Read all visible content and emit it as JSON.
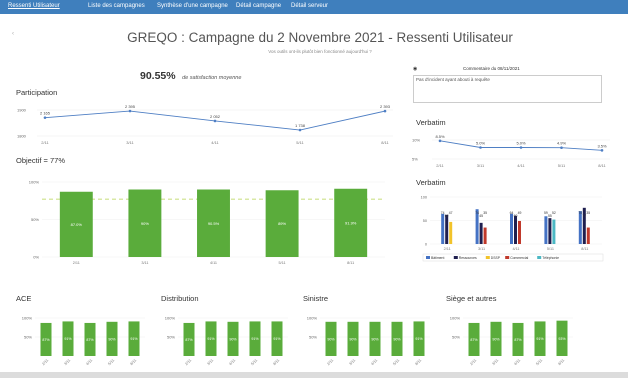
{
  "nav": {
    "items": [
      "Ressenti Utilisateur",
      "Liste des campagnes",
      "Synthèse d'une campagne",
      "Détail campagne",
      "Détail serveur"
    ]
  },
  "page": {
    "title": "GREQO : Campagne du 2 Novembre 2021 - Ressenti Utilisateur",
    "subtitle": "Vos outils ont-ils plutôt bien fonctionné aujourd'hui ?",
    "satisfaction_value": "90.55%",
    "satisfaction_label": "de satisfaction moyenne",
    "back_icon": "chevron-left-icon"
  },
  "comment": {
    "header": "Commentaire du 08/11/2021",
    "text": "Pas d'incident ayant abouti à requête"
  },
  "sections": {
    "participation": "Participation",
    "objectif": "Objectif = 77%",
    "verbatim1": "Verbatim",
    "verbatim2": "Verbatim",
    "ace": "ACE",
    "distribution": "Distribution",
    "sinistre": "Sinistre",
    "siege": "Siège et autres"
  },
  "chart_data": [
    {
      "id": "participation",
      "type": "line",
      "x": [
        "2/11",
        "3/11",
        "4/11",
        "5/11",
        "8/11"
      ],
      "y_ticks": [
        "1900",
        "1800"
      ],
      "values": [
        2165,
        2395,
        2052,
        1738,
        2393
      ],
      "labels": [
        "2 165",
        "2 395",
        "2 052",
        "1 738",
        "2 393"
      ]
    },
    {
      "id": "objectif",
      "type": "bar",
      "categories": [
        "2/11",
        "3/11",
        "4/11",
        "5/11",
        "8/11"
      ],
      "values": [
        87.0,
        90.0,
        90.0,
        89.0,
        91.0
      ],
      "labels": [
        "87.0%",
        "90%",
        "90.5%",
        "89%",
        "91.9%"
      ],
      "y_ticks": [
        "100%",
        "50%",
        "0%"
      ],
      "target": 77,
      "color": "#5aac3b"
    },
    {
      "id": "verbatim_line",
      "type": "line",
      "x": [
        "2/11",
        "3/11",
        "4/11",
        "5/11",
        "8/11"
      ],
      "y_ticks": [
        "10%",
        "5%"
      ],
      "values": [
        8.5,
        5.0,
        5.0,
        4.9,
        3.5
      ],
      "labels": [
        "8.5%",
        "5.0%",
        "5.0%",
        "4.9%",
        "3.5%"
      ]
    },
    {
      "id": "verbatim_bars",
      "type": "bar",
      "categories": [
        "2/11",
        "3/11",
        "4/11",
        "5/11",
        "8/11"
      ],
      "y_ticks": [
        "100",
        "50",
        "0"
      ],
      "series": [
        {
          "name": "Bâtiment",
          "color": "#4472c4",
          "values": [
            64,
            74,
            64,
            59,
            70
          ]
        },
        {
          "name": "Ressources",
          "color": "#1f1f4f",
          "values": [
            62,
            45,
            60,
            55,
            77
          ]
        },
        {
          "name": "DSSP",
          "color": "#f2c32a",
          "values": [
            47,
            0,
            0,
            0,
            0
          ]
        },
        {
          "name": "Commercial",
          "color": "#c0392b",
          "values": [
            0,
            35,
            49,
            0,
            35
          ]
        },
        {
          "name": "Téléphonie",
          "color": "#4cb8c4",
          "values": [
            0,
            0,
            0,
            52,
            0
          ]
        }
      ],
      "labels": [
        [
          "74",
          "62",
          "47"
        ],
        [
          "74",
          "45",
          "35"
        ],
        [
          "64",
          "60",
          "49"
        ],
        [
          "59",
          "55",
          "52"
        ],
        [
          "70",
          "77",
          "35"
        ]
      ]
    },
    {
      "id": "ace",
      "type": "bar",
      "categories": [
        "2/11",
        "3/11",
        "4/11",
        "5/11",
        "8/11"
      ],
      "values": [
        87,
        91,
        87,
        90,
        91
      ],
      "labels": [
        "87%",
        "91%",
        "87%",
        "90%",
        "91%"
      ],
      "y_ticks": [
        "100%",
        "50%"
      ],
      "color": "#5aac3b"
    },
    {
      "id": "distribution",
      "type": "bar",
      "categories": [
        "2/11",
        "3/11",
        "4/11",
        "5/11",
        "8/11"
      ],
      "values": [
        87,
        91,
        90,
        91,
        91
      ],
      "labels": [
        "87%",
        "91%",
        "90%",
        "91%",
        "91%"
      ],
      "y_ticks": [
        "100%",
        "50%"
      ],
      "color": "#5aac3b"
    },
    {
      "id": "sinistre",
      "type": "bar",
      "categories": [
        "2/11",
        "3/11",
        "4/11",
        "5/11",
        "8/11"
      ],
      "values": [
        90,
        90,
        90,
        90,
        91
      ],
      "labels": [
        "90%",
        "90%",
        "90%",
        "90%",
        "91%"
      ],
      "y_ticks": [
        "100%",
        "50%"
      ],
      "color": "#5aac3b"
    },
    {
      "id": "siege",
      "type": "bar",
      "categories": [
        "2/11",
        "3/11",
        "4/11",
        "5/11",
        "8/11"
      ],
      "values": [
        87,
        90,
        87,
        91,
        93
      ],
      "labels": [
        "87%",
        "90%",
        "87%",
        "91%",
        "93%"
      ],
      "y_ticks": [
        "100%",
        "50%"
      ],
      "color": "#5aac3b"
    }
  ]
}
